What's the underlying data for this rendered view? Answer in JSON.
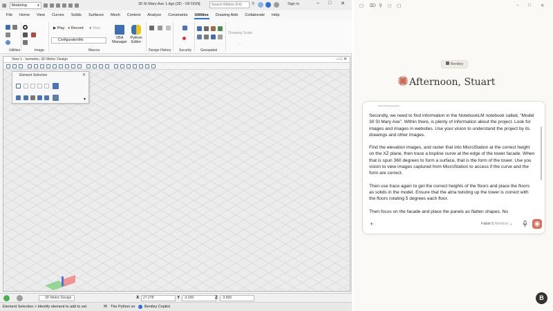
{
  "microstation": {
    "workflow": "Modeling",
    "doc_title": "30 St Mary Axe 1.dgn [3D - V8 DGN]",
    "search_placeholder": "Search Ribbon (F4)",
    "signin": "Sign in",
    "menu": [
      "File",
      "Home",
      "View",
      "Curves",
      "Solids",
      "Surfaces",
      "Mesh",
      "Content",
      "Analyze",
      "Constraints",
      "Utilities",
      "Drawing Aids",
      "Collaborate",
      "Help"
    ],
    "active_menu": "Utilities",
    "ribbon": {
      "play": "Play",
      "record": "Record",
      "stop": "Stop",
      "config_dropdown": "ConfigurationMo",
      "vba_manager": "VBA Manager",
      "python_editor": "Python Editor",
      "drawing_scale": "Drawing Scale",
      "groups": {
        "utilities": "Utilities",
        "image": "Image",
        "macros": "Macros",
        "design_history": "Design History",
        "security": "Security",
        "geospatial": "Geospatial"
      }
    },
    "view": {
      "title": "View 1 - Isometric, 3D Metric Design"
    },
    "element_selection": {
      "title": "Element Selection"
    },
    "status": {
      "model": "3D Metric Design",
      "x_label": "X",
      "x_value": "27.278",
      "y_label": "Y",
      "y_value": "-3.039",
      "z_label": "Z",
      "z_value": "-3.800",
      "prompt": "Element Selection > Identify element to add to set",
      "python_msg": "The Python so",
      "copilot": "Bentley Copilot"
    }
  },
  "chat": {
    "org": "Bentley",
    "greeting": "Afternoon, Stuart",
    "composer_header": "•••••••••••••••",
    "paragraphs": [
      "Secondly, we need to find information in the NotebookLM notebook called, “Model 30 St Mary Axe”. Within there, is plenty of information about the project. Look for images and images in websites. Use your vision to understand the project by its drawings and other images.",
      "Find the elevation images, and raster that into MicroStation at the correct height on the XZ plane, then trace a bspline curve at the edge of the tower facade. When that is spun 360 degrees to form a surface, that is the form of the tower. Use you vision to view images captured from MicroStation to access if the curve and the form are correct.",
      "Then use trace again to get the correct heights of the floors and place the floors as solids in the model. Ensure that the atria twisting up the tower is correct with the floors rotating 5 degrees each floor.",
      "Then focus on the facade and place the panels as flatten shapes. No"
    ],
    "model_name": "Fable 5",
    "effort": "Medium",
    "add_label": "+",
    "fab_label": "B",
    "colors": {
      "accent": "#d96f5a",
      "star": "#c96a52"
    }
  }
}
